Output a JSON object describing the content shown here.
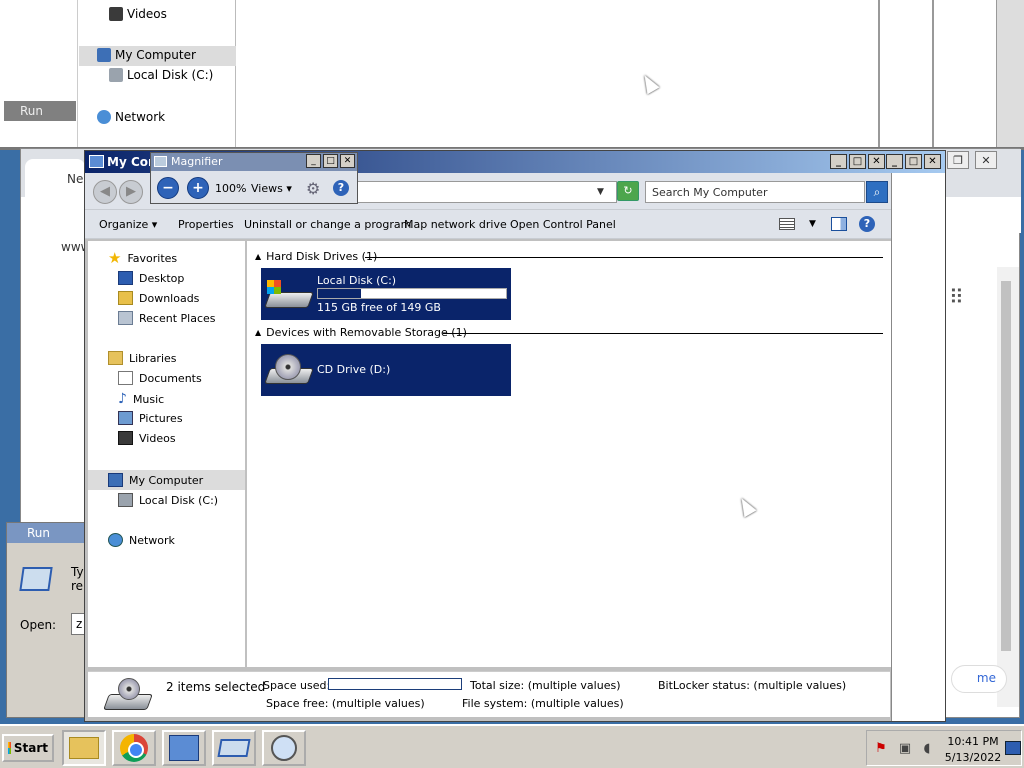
{
  "magnified_view": {
    "nav_items": [
      "Videos",
      "My Computer",
      "Local Disk (C:)",
      "Network"
    ],
    "run_label": "Run"
  },
  "chrome": {
    "tab_label": "New",
    "url_fragment": "www",
    "home_button": "me",
    "window_ctrls": [
      "❐",
      "✕"
    ]
  },
  "run_dialog": {
    "title": "Run",
    "text_line1": "Ty",
    "text_line2": "re:",
    "open_label": "Open:",
    "open_value": "z"
  },
  "explorer": {
    "title": "My Com",
    "address_value": "",
    "search_placeholder": "Search My Computer",
    "commands": {
      "organize": "Organize ▾",
      "properties": "Properties",
      "uninstall": "Uninstall or change a program",
      "map_drive": "Map network drive",
      "control_panel": "Open Control Panel"
    },
    "nav": {
      "favorites": "Favorites",
      "desktop": "Desktop",
      "downloads": "Downloads",
      "recent": "Recent Places",
      "libraries": "Libraries",
      "documents": "Documents",
      "music": "Music",
      "pictures": "Pictures",
      "videos": "Videos",
      "my_computer": "My Computer",
      "local_disk": "Local Disk (C:)",
      "network": "Network"
    },
    "groups": {
      "hdd_header": "Hard Disk Drives (1)",
      "removable_header": "Devices with Removable Storage (1)"
    },
    "drives": {
      "c_name": "Local Disk (C:)",
      "c_free": "115 GB free of 149 GB",
      "c_used_fraction": 0.228,
      "d_name": "CD Drive (D:)"
    },
    "status": {
      "selected": "2 items selected",
      "space_used_label": "Space used:",
      "total_size": "Total size: (multiple values)",
      "bitlocker": "BitLocker status: (multiple values)",
      "space_free": "Space free: (multiple values)",
      "file_system": "File system: (multiple values)"
    }
  },
  "magnifier": {
    "title": "Magnifier",
    "zoom": "100%",
    "views": "Views ▾"
  },
  "taskbar": {
    "start": "Start",
    "time": "10:41 PM",
    "date": "5/13/2022"
  }
}
